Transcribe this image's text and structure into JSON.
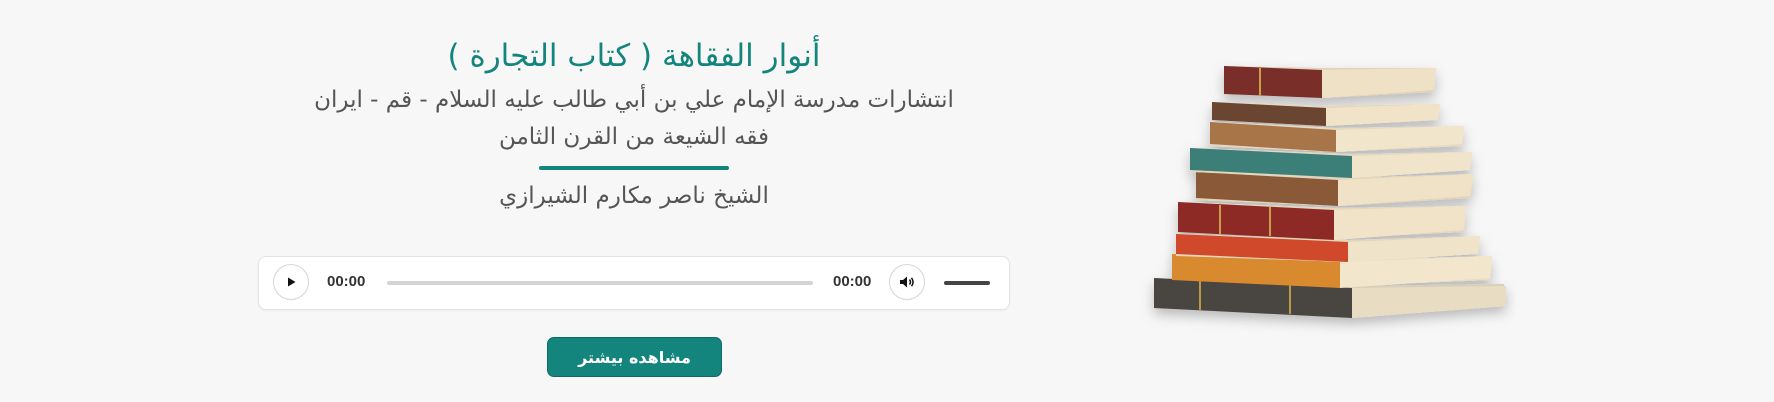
{
  "book": {
    "title": "أنوار الفقاهة ( كتاب التجارة )",
    "publisher": "انتشارات مدرسة الإمام علي بن أبي طالب عليه السلام - قم - ايران",
    "category": "فقه الشيعة من القرن الثامن",
    "author": "الشيخ ناصر مكارم الشيرازي"
  },
  "player": {
    "current_time": "00:00",
    "total_time": "00:00",
    "progress": 0,
    "play_icon": "play-icon",
    "volume_icon": "volume-icon"
  },
  "actions": {
    "more_label": "مشاهده بیشتر"
  },
  "image": {
    "icon": "book-stack-illustration"
  },
  "colors": {
    "accent": "#14857d",
    "background": "#f7f7f7",
    "text": "#555555"
  }
}
